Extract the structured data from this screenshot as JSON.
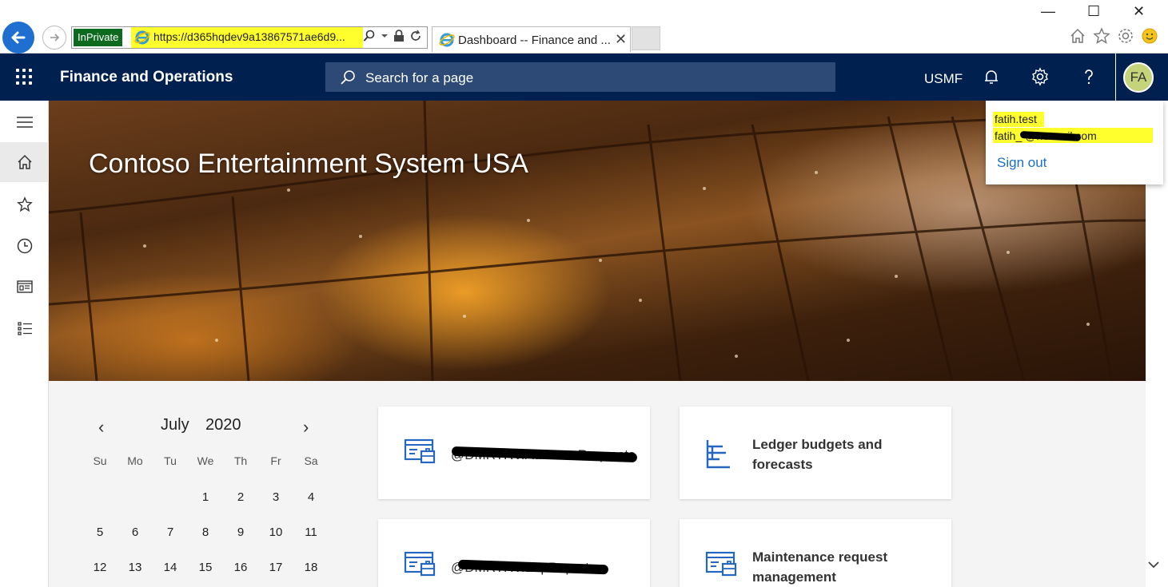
{
  "browser": {
    "inprivate_label": "InPrivate",
    "url": "https://d365hqdev9a13867571ae6d9...",
    "tab_title": "Dashboard -- Finance and ...",
    "tab_close": "✕",
    "win_minimize": "—",
    "win_maximize": "☐",
    "win_close": "✕"
  },
  "header": {
    "app_title": "Finance and Operations",
    "search_placeholder": "Search for a page",
    "company": "USMF",
    "avatar_initials": "FA"
  },
  "nav": {
    "items": [
      "menu-icon",
      "home-icon",
      "favorites-icon",
      "recent-icon",
      "workspaces-icon",
      "modules-icon"
    ]
  },
  "hero": {
    "title": "Contoso Entertainment System USA"
  },
  "calendar": {
    "month": "July",
    "year": "2020",
    "prev": "‹",
    "next": "›",
    "weekdays": [
      "Su",
      "Mo",
      "Tu",
      "We",
      "Th",
      "Fr",
      "Sa"
    ],
    "rows": [
      [
        "",
        "",
        "",
        "1",
        "2",
        "3",
        "4"
      ],
      [
        "5",
        "6",
        "7",
        "8",
        "9",
        "10",
        "11"
      ],
      [
        "12",
        "13",
        "14",
        "15",
        "16",
        "17",
        "18"
      ]
    ]
  },
  "tiles": [
    {
      "label": "@DMRTRV.AdvanceRequests",
      "icon": "workspace-icon"
    },
    {
      "label": "Ledger budgets and forecasts",
      "icon": "list-icon"
    },
    {
      "label": "@DMRTRV.ExpReports",
      "icon": "workspace-icon"
    },
    {
      "label": "Maintenance request management",
      "icon": "workspace-icon"
    }
  ],
  "profile": {
    "username": "fatih.test",
    "email": "fatih_ @hotmail.com",
    "sign_out": "Sign out"
  },
  "colors": {
    "header_bg": "#002050",
    "search_bg": "#2c4a75",
    "accent_blue": "#1a6ec7",
    "highlight": "#ffff2e",
    "avatar_bg": "#c5d37b"
  }
}
